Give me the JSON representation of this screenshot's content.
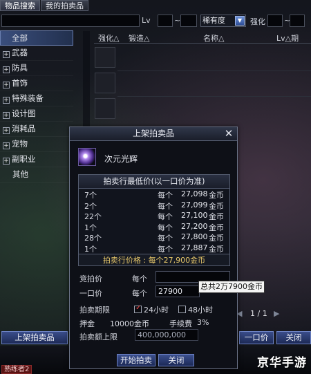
{
  "tabs": [
    {
      "label": "物品搜索"
    },
    {
      "label": "我的拍卖品"
    }
  ],
  "search": {
    "lv_label": "Lv",
    "range_sep": "~",
    "rarity_value": "稀有度",
    "enhance_label": "强化"
  },
  "categories": [
    {
      "label": "全部"
    },
    {
      "label": "武器"
    },
    {
      "label": "防具"
    },
    {
      "label": "首饰"
    },
    {
      "label": "特殊装备"
    },
    {
      "label": "设计图"
    },
    {
      "label": "消耗品"
    },
    {
      "label": "宠物"
    },
    {
      "label": "副职业"
    },
    {
      "label": "其他"
    }
  ],
  "list_header": {
    "col1": "强化△",
    "col2": "锻造△",
    "col3": "名称△",
    "col4": "Lv△期"
  },
  "pager": {
    "text": "1 / 1"
  },
  "bottom_buttons": {
    "list_item": "上架拍卖品",
    "buy_now": "一口价",
    "close": "关闭"
  },
  "player_badge": "熟练者2",
  "watermark": "京华手游",
  "dialog": {
    "title": "上架拍卖品",
    "item_name": "次元光辉",
    "price_table_title": "拍卖行最低价(以一口价为准)",
    "price_rows": [
      {
        "qty": "7个",
        "per": "每个",
        "amount": "27,098",
        "unit": "金币"
      },
      {
        "qty": "2个",
        "per": "每个",
        "amount": "27,099",
        "unit": "金币"
      },
      {
        "qty": "22个",
        "per": "每个",
        "amount": "27,100",
        "unit": "金币"
      },
      {
        "qty": "1个",
        "per": "每个",
        "amount": "27,200",
        "unit": "金币"
      },
      {
        "qty": "28个",
        "per": "每个",
        "amount": "27,800",
        "unit": "金币"
      },
      {
        "qty": "1个",
        "per": "每个",
        "amount": "27,887",
        "unit": "金币"
      }
    ],
    "market_price": "拍卖行价格 : 每个27,900金币",
    "bid_label": "竞拍价",
    "bid_per": "每个",
    "bid_value": "",
    "buyout_label": "一口价",
    "buyout_per": "每个",
    "buyout_value": "27900",
    "buyout_tooltip": "总共2万7900金币",
    "period_label": "拍卖期限",
    "period_24": "24小时",
    "period_48": "48小时",
    "period_24_checked": true,
    "deposit_label": "押金",
    "deposit_value": "10000金币",
    "fee_label": "手续费",
    "fee_value": "3%",
    "limit_label": "拍卖额上限",
    "limit_value": "400,000,000",
    "start_button": "开始拍卖",
    "close_button": "关闭"
  }
}
